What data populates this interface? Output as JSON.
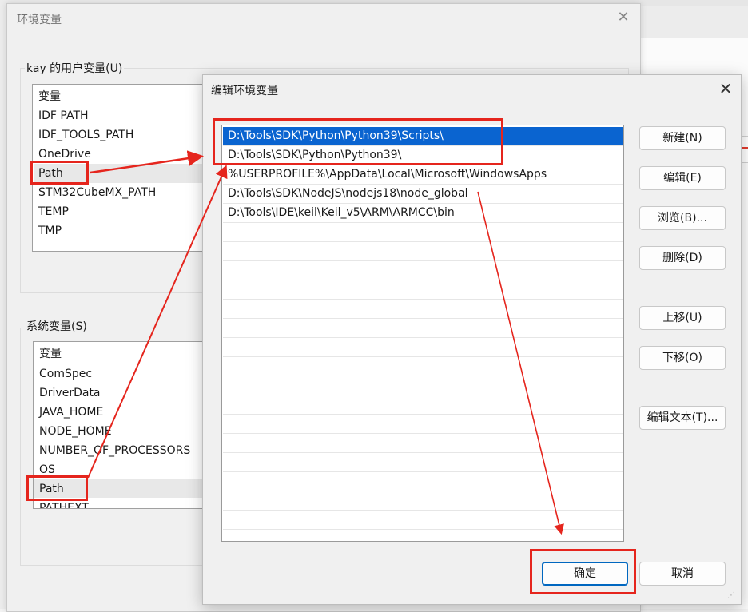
{
  "env_dialog": {
    "title": "环境变量",
    "close_icon": "close-icon",
    "user_group_label": "kay 的用户变量(U)",
    "user_vars": {
      "header": "变量",
      "items": [
        "IDF PATH",
        "IDF_TOOLS_PATH",
        "OneDrive",
        "Path",
        "STM32CubeMX_PATH",
        "TEMP",
        "TMP"
      ],
      "selected": "Path"
    },
    "system_group_label": "系统变量(S)",
    "system_vars": {
      "header": "变量",
      "items": [
        "ComSpec",
        "DriverData",
        "JAVA_HOME",
        "NODE_HOME",
        "NUMBER_OF_PROCESSORS",
        "OS",
        "Path",
        "PATHEXT"
      ],
      "selected": "Path"
    }
  },
  "edit_dialog": {
    "title": "编辑环境变量",
    "close_icon": "close-icon",
    "paths": [
      "D:\\Tools\\SDK\\Python\\Python39\\Scripts\\",
      "D:\\Tools\\SDK\\Python\\Python39\\",
      "%USERPROFILE%\\AppData\\Local\\Microsoft\\WindowsApps",
      "D:\\Tools\\SDK\\NodeJS\\nodejs18\\node_global",
      "D:\\Tools\\IDE\\keil\\Keil_v5\\ARM\\ARMCC\\bin"
    ],
    "selected_index": 0,
    "buttons": {
      "new": "新建(N)",
      "edit": "编辑(E)",
      "browse": "浏览(B)...",
      "delete": "删除(D)",
      "move_up": "上移(U)",
      "move_down": "下移(O)",
      "edit_text": "编辑文本(T)...",
      "ok": "确定",
      "cancel": "取消"
    }
  },
  "annotation_color": "#e5251d",
  "selection_color": "#0a64d0"
}
